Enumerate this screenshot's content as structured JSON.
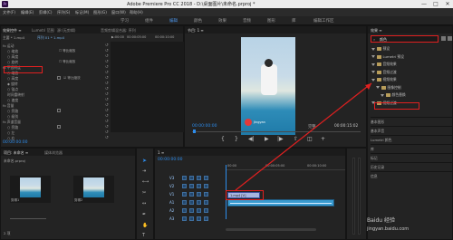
{
  "app": {
    "title": "Adobe Premiere Pro CC 2018 - D:\\桌面图片\\未命名.prproj *",
    "logo": "Pr"
  },
  "window_controls": [
    "—",
    "□",
    "✕"
  ],
  "menu": [
    "文件(F)",
    "编辑(E)",
    "剪辑(C)",
    "序列(S)",
    "标记(M)",
    "图形(G)",
    "窗口(W)",
    "帮助(H)"
  ],
  "workspaces": [
    "学习",
    "组件",
    "编辑",
    "颜色",
    "效果",
    "音频",
    "图形",
    "库",
    "编辑工作区"
  ],
  "source_panel": {
    "tabs": [
      "效果控件 ≡",
      "Lumetri 范围",
      "源:(无剪辑)",
      "音频剪辑混合器: 序列"
    ],
    "master": "主要 * 1.mp4",
    "seq": "序列 01 * 1.mp4",
    "ruler": [
      "▶:00:00",
      "00:00:05:00",
      "00:00:10:00"
    ],
    "rows": [
      {
        "label": "fx 运动",
        "has_check": false
      },
      {
        "label": "○ 缩放",
        "has_check": false
      },
      {
        "label": "○ 高度",
        "has_check": false
      },
      {
        "label": "○ 旋转",
        "has_check": false
      },
      {
        "label": "fx 不透明度",
        "has_check": false
      },
      {
        "label": "○ 缩放",
        "has_check": false
      },
      {
        "label": "○ 高度",
        "has_check": true,
        "check_label": "☑ 等比缩放"
      },
      {
        "label": "◆ 旋转",
        "has_check": false
      },
      {
        "label": "○ 锚点",
        "has_check": false
      },
      {
        "label": "时间重映射",
        "has_check": false
      },
      {
        "label": "○ 速度",
        "has_check": false
      },
      {
        "label": "fx 音量",
        "has_check": false
      },
      {
        "label": "○ 旁路",
        "has_check": true,
        "check_label": ""
      },
      {
        "label": "○ 级别",
        "has_check": false
      },
      {
        "label": "fx 声道音量",
        "has_check": false
      },
      {
        "label": "○ 旁路",
        "has_check": true,
        "check_label": ""
      },
      {
        "label": "○ 左",
        "has_check": false
      },
      {
        "label": "○ 右",
        "has_check": false
      },
      {
        "label": "fx 声像器",
        "has_check": false
      },
      {
        "label": "○ 平衡",
        "has_check": false
      }
    ],
    "uniform_scale_1": "☐ 等比缩放",
    "uniform_scale_2": "☐ 等比缩放",
    "timecode": "00:00:00:00"
  },
  "program_panel": {
    "tab": "节目: 1 ≡",
    "timecode_left": "00:00:00:00",
    "fit": "完整",
    "timecode_right": "00:00:15:02",
    "watermark": "Jingyan"
  },
  "project_panel": {
    "tabs": [
      "项目: 未命名 ≡",
      "媒体浏览器"
    ],
    "file": "未命名.prproj",
    "items": [
      "剪辑1",
      "剪辑2"
    ],
    "count": "2 项"
  },
  "timeline": {
    "tab": "1 ≡",
    "timecode": "00:00:00:00",
    "ruler": [
      "00:00",
      "00:00:05:00",
      "00:00:10:00"
    ],
    "tracks": [
      "V3",
      "V2",
      "V1",
      "A1",
      "A2",
      "A3"
    ],
    "clip_label": "1.mp4 [V]"
  },
  "effects_panel": {
    "tab": "效果 ≡",
    "search_value": "颜色",
    "tree": [
      {
        "label": "预设",
        "indent": 0,
        "highlight": false
      },
      {
        "label": "Lumetri 预设",
        "indent": 0,
        "highlight": false
      },
      {
        "label": "音频效果",
        "indent": 0,
        "highlight": false
      },
      {
        "label": "音频过渡",
        "indent": 0,
        "highlight": false
      },
      {
        "label": "视频效果",
        "indent": 0,
        "highlight": false
      },
      {
        "label": "图像控制",
        "indent": 1,
        "highlight": false
      },
      {
        "label": "颜色替换",
        "indent": 2,
        "highlight": true
      },
      {
        "label": "视频过渡",
        "indent": 0,
        "highlight": false
      }
    ],
    "sections": [
      "基本图形",
      "基本声音",
      "Lumetri 颜色",
      "库",
      "标记",
      "历史记录",
      "信息"
    ]
  },
  "footer": {
    "url": "jingyan.baidu.com",
    "brand": "Baidu 经验"
  },
  "colors": {
    "accent_blue": "#2d8ceb",
    "highlight_red": "#e02020",
    "panel_bg": "#232323"
  },
  "icons": [
    "pr-logo-icon",
    "selection-tool-icon",
    "razor-tool-icon",
    "play-icon",
    "folder-icon",
    "search-icon",
    "wrench-icon"
  ]
}
